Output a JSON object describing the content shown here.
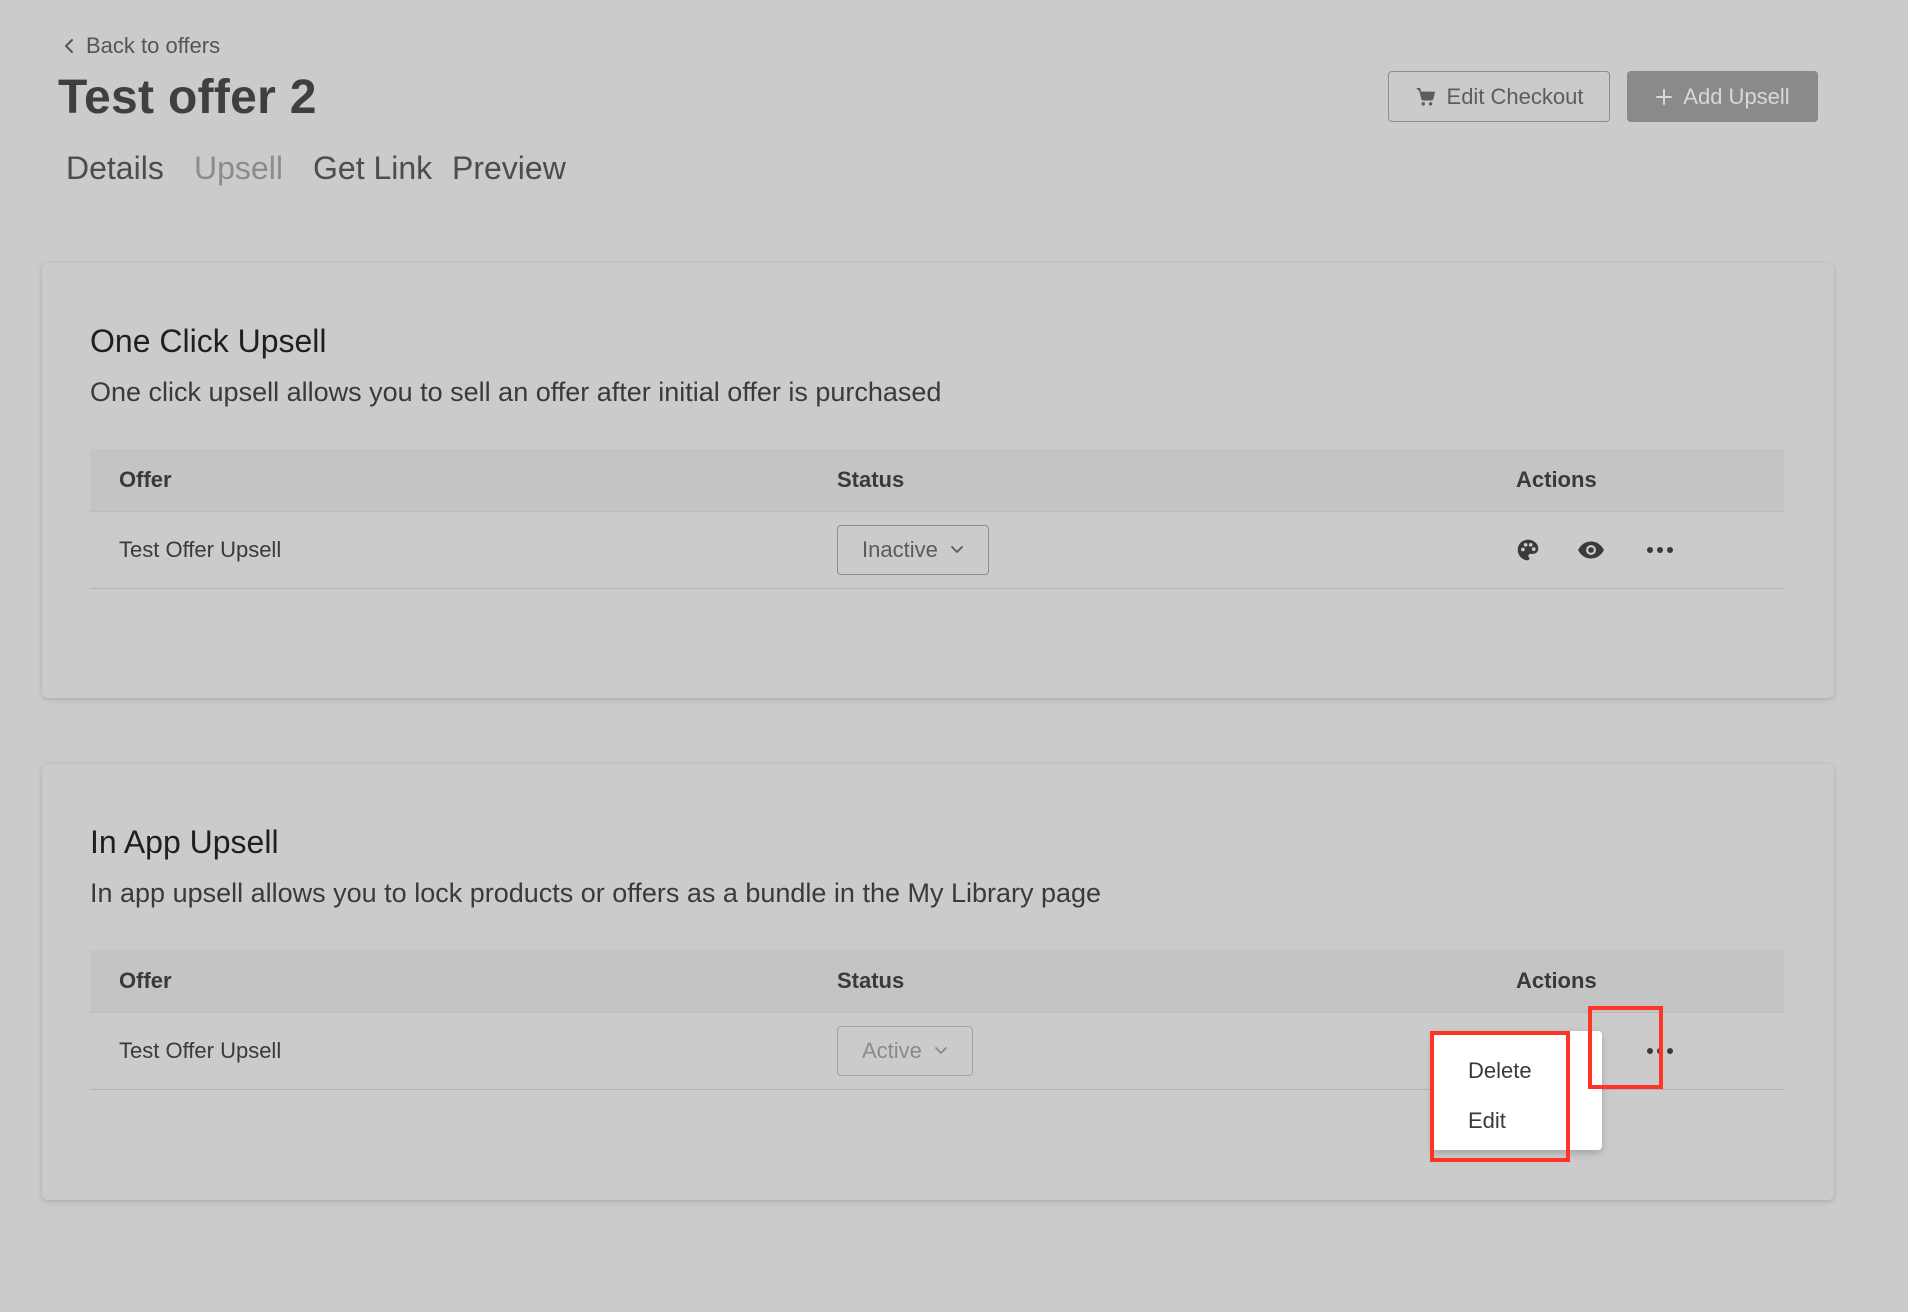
{
  "header": {
    "back_label": "Back to offers",
    "title": "Test offer 2",
    "edit_checkout_label": "Edit Checkout",
    "add_upsell_label": "Add Upsell"
  },
  "tabs": [
    {
      "label": "Details"
    },
    {
      "label": "Upsell",
      "active": true
    },
    {
      "label": "Get Link"
    },
    {
      "label": "Preview"
    }
  ],
  "sections": [
    {
      "title": "One Click Upsell",
      "description": "One click upsell allows you to sell an offer after initial offer is purchased",
      "columns": [
        "Offer",
        "Status",
        "Actions"
      ],
      "rows": [
        {
          "offer": "Test Offer Upsell",
          "status": "Inactive",
          "actions": [
            "palette-icon",
            "eye-icon",
            "more-icon"
          ]
        }
      ]
    },
    {
      "title": "In App Upsell",
      "description": "In app upsell allows you to lock products or offers as a bundle in the My Library page",
      "columns": [
        "Offer",
        "Status",
        "Actions"
      ],
      "rows": [
        {
          "offer": "Test Offer Upsell",
          "status": "Active",
          "actions": [
            "more-icon"
          ]
        }
      ]
    }
  ],
  "dropdown_menu": {
    "items": [
      "Delete",
      "Edit"
    ]
  },
  "colors": {
    "background": "#cbcbcb",
    "primary_button": "#8a8a8a",
    "highlight": "#ff3326"
  }
}
